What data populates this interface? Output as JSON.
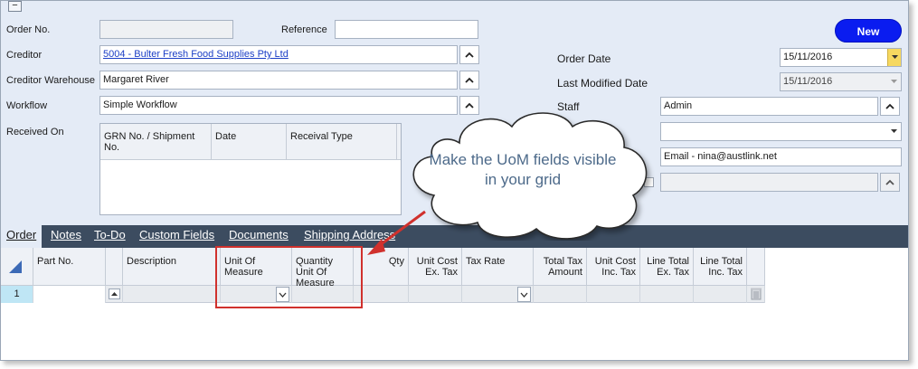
{
  "header": {
    "collapse_symbol": "−",
    "order_no_label": "Order No.",
    "order_no_value": "",
    "reference_label": "Reference",
    "reference_value": "",
    "creditor_label": "Creditor",
    "creditor_value": "5004 - Bulter Fresh Food Supplies Pty Ltd",
    "creditor_warehouse_label": "Creditor Warehouse",
    "creditor_warehouse_value": "Margaret River",
    "workflow_label": "Workflow",
    "workflow_value": "Simple Workflow",
    "received_on_label": "Received On",
    "new_button": "New",
    "order_date_label": "Order Date",
    "order_date_value": "15/11/2016",
    "last_modified_label": "Last Modified Date",
    "last_modified_value": "15/11/2016",
    "staff_label": "Staff",
    "staff_value": "Admin",
    "contact_value": "",
    "email_value": "Email - nina@austlink.net",
    "extra_value": ""
  },
  "grn_grid": {
    "columns": [
      "GRN No. / Shipment No.",
      "Date",
      "Receival Type"
    ]
  },
  "tabs": [
    {
      "label": "Order"
    },
    {
      "label": "Notes"
    },
    {
      "label": "To-Do"
    },
    {
      "label": "Custom Fields"
    },
    {
      "label": "Documents"
    },
    {
      "label": "Shipping Address"
    }
  ],
  "order_grid": {
    "columns": [
      {
        "label": "Part No."
      },
      {
        "label": "Description"
      },
      {
        "label": "Unit Of Measure"
      },
      {
        "label": "Quantity Unit Of Measure"
      },
      {
        "label": "Qty"
      },
      {
        "label": "Unit Cost Ex. Tax"
      },
      {
        "label": "Tax Rate"
      },
      {
        "label": "Total Tax Amount"
      },
      {
        "label": "Unit Cost Inc. Tax"
      },
      {
        "label": "Line Total Ex. Tax"
      },
      {
        "label": "Line Total Inc. Tax"
      }
    ],
    "row_number": "1"
  },
  "callout": {
    "text": "Make the UoM fields visible in your grid"
  },
  "colors": {
    "accent": "#0a1cf0",
    "highlight": "#d0312d",
    "tabs_bar": "#3c4c60",
    "callout_text": "#4d6a8a"
  }
}
